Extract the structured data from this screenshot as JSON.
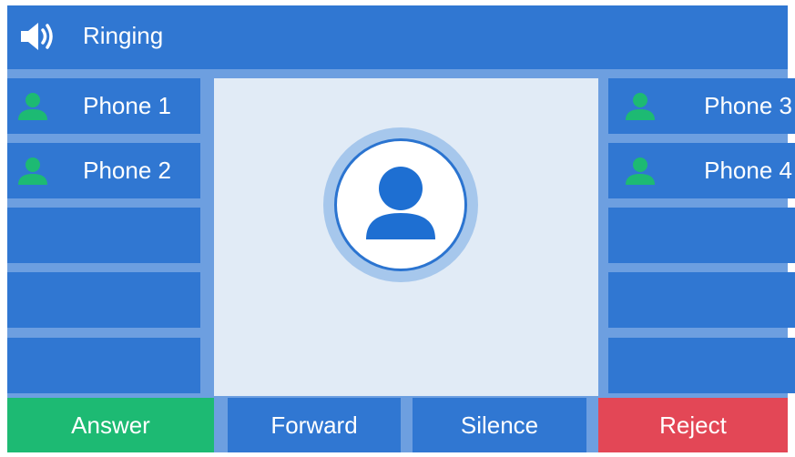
{
  "header": {
    "icon": "speaker-icon",
    "title": "Ringing"
  },
  "line_keys": {
    "left": [
      {
        "label": "Phone 1",
        "icon": "user-icon",
        "icon_color": "#1dba73"
      },
      {
        "label": "Phone 2",
        "icon": "user-icon",
        "icon_color": "#1dba73"
      },
      {
        "label": ""
      },
      {
        "label": ""
      },
      {
        "label": ""
      }
    ],
    "right": [
      {
        "label": "Phone 3",
        "icon": "user-icon",
        "icon_color": "#1dba73"
      },
      {
        "label": "Phone 4",
        "icon": "user-icon",
        "icon_color": "#1dba73"
      },
      {
        "label": ""
      },
      {
        "label": ""
      },
      {
        "label": ""
      }
    ]
  },
  "caller": {
    "avatar_icon": "contact-avatar-icon"
  },
  "softkeys": {
    "answer": "Answer",
    "forward": "Forward",
    "silence": "Silence",
    "reject": "Reject"
  },
  "colors": {
    "background": "#6d9fe0",
    "tile": "#3077d2",
    "panel": "#e1ebf6",
    "answer": "#1dba73",
    "reject": "#e34756",
    "avatar_ring": "#a6c7ec",
    "avatar_figure": "#1e6fd2"
  }
}
